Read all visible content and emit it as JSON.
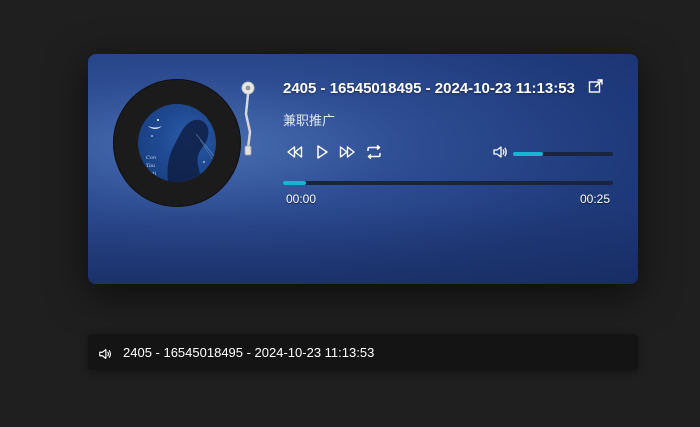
{
  "player": {
    "title": "2405 - 16545018495 - 2024-10-23 11:13:53",
    "artist": "兼职推广",
    "current_time": "00:00",
    "duration": "00:25",
    "progress_fraction": 0.07,
    "volume_fraction": 0.3,
    "controls": [
      "rewind-icon",
      "play-icon",
      "fast-forward-icon",
      "repeat-icon"
    ],
    "volume_icon": "volume-icon",
    "share_icon": "share-icon"
  },
  "mini_player": {
    "title": "2405 - 16545018495 - 2024-10-23 11:13:53",
    "icon": "volume-icon"
  },
  "colors": {
    "page_bg": "#1f1f1f",
    "accent": "#17b4d4",
    "panel_bg": "#2d4c92"
  }
}
